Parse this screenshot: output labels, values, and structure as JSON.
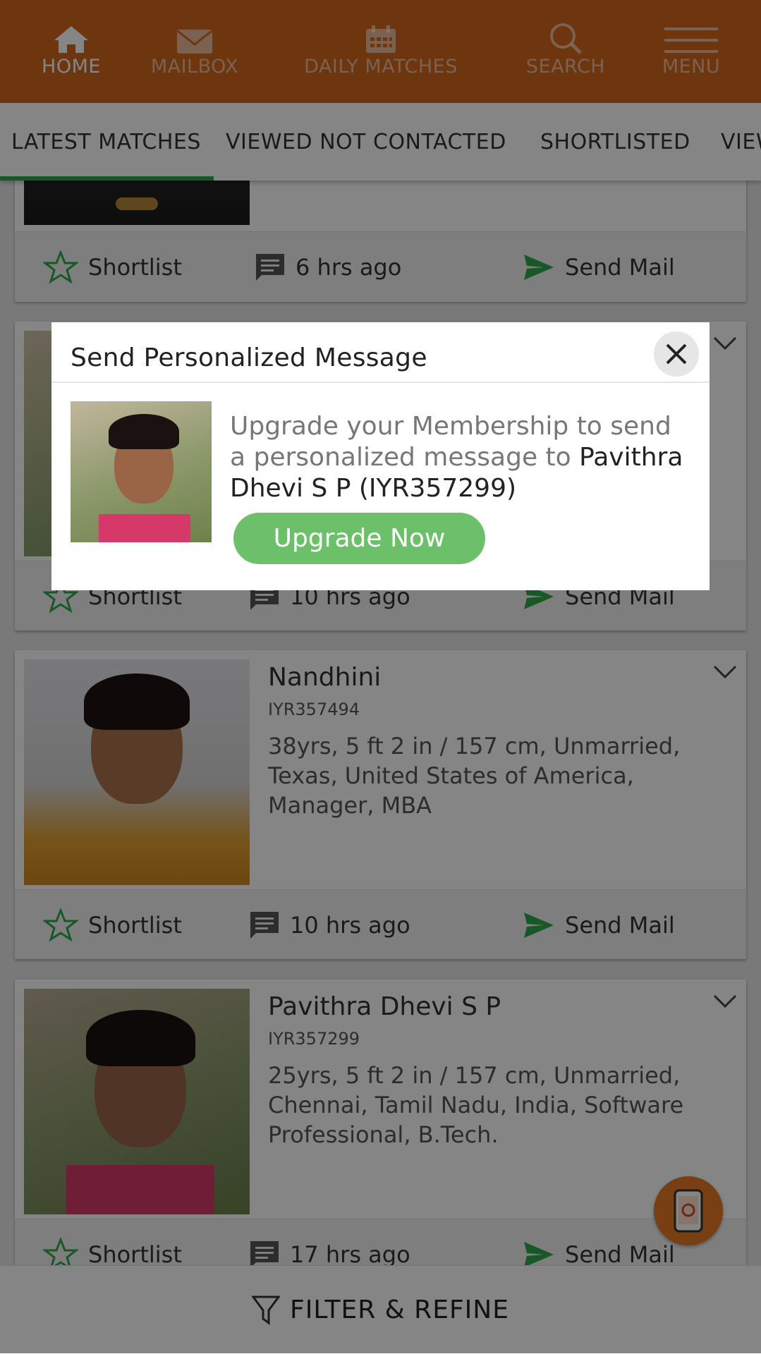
{
  "nav": {
    "items": [
      {
        "label": "HOME",
        "icon": "home-icon"
      },
      {
        "label": "MAILBOX",
        "icon": "mail-icon"
      },
      {
        "label": "DAILY MATCHES",
        "icon": "calendar-icon"
      },
      {
        "label": "SEARCH",
        "icon": "search-icon"
      },
      {
        "label": "MENU",
        "icon": "hamburger-icon"
      }
    ],
    "color": "#d2691e"
  },
  "tabs": [
    {
      "label": "LATEST MATCHES"
    },
    {
      "label": "VIEWED NOT CONTACTED"
    },
    {
      "label": "SHORTLISTED"
    },
    {
      "label": "VIEWED"
    }
  ],
  "cards": [
    {
      "time": "6 hrs ago",
      "shortlist": "Shortlist",
      "send_mail": "Send Mail"
    },
    {
      "time": "10 hrs ago",
      "shortlist": "Shortlist",
      "send_mail": "Send Mail"
    },
    {
      "name": "Nandhini",
      "id": "IYR357494",
      "details": "38yrs, 5 ft 2 in / 157 cm, Unmarried, Texas, United States of America, Manager, MBA",
      "time": "10 hrs ago",
      "shortlist": "Shortlist",
      "send_mail": "Send Mail"
    },
    {
      "name": "Pavithra Dhevi S P",
      "id": "IYR357299",
      "details": "25yrs, 5 ft 2 in / 157 cm, Unmarried, Chennai, Tamil Nadu, India, Software Professional, B.Tech.",
      "time": "17 hrs ago",
      "shortlist": "Shortlist",
      "send_mail": "Send Mail"
    }
  ],
  "modal": {
    "title": "Send Personalized Message",
    "text_prefix": "Upgrade your Membership to send a personalized message to ",
    "recipient": "Pavithra Dhevi S P (IYR357299)",
    "button": "Upgrade Now"
  },
  "bottom": {
    "filter_label": "FILTER & REFINE"
  },
  "colors": {
    "accent_green": "#2eaa4a",
    "button_green": "#6cc06a",
    "send_green": "#2eaa4a"
  }
}
